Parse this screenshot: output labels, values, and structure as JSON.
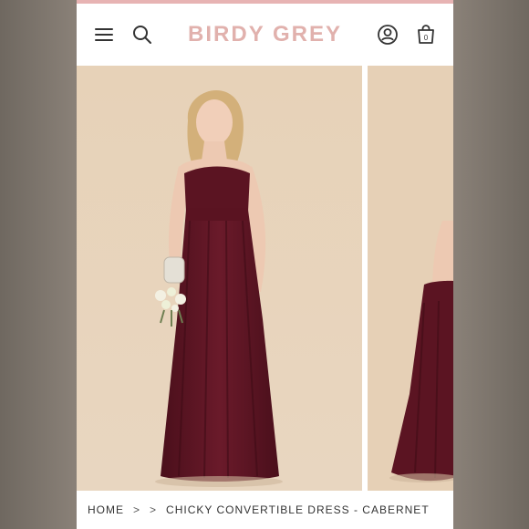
{
  "brand": {
    "name": "BIRDY GREY",
    "color": "#e1b1ad"
  },
  "header": {
    "menu_icon": "menu-icon",
    "search_icon": "search-icon",
    "account_icon": "account-icon",
    "cart_icon": "shopping-bag-icon",
    "cart_count": "0"
  },
  "gallery": {
    "slides": [
      {
        "name": "main-image",
        "subject": "model wearing dress"
      },
      {
        "name": "next-image",
        "subject": "dress detail"
      }
    ],
    "dress_color": "#5b1422"
  },
  "breadcrumb": {
    "home": "HOME",
    "sep1": ">",
    "sep2": ">",
    "current": "CHICKY CONVERTIBLE DRESS - CABERNET"
  }
}
